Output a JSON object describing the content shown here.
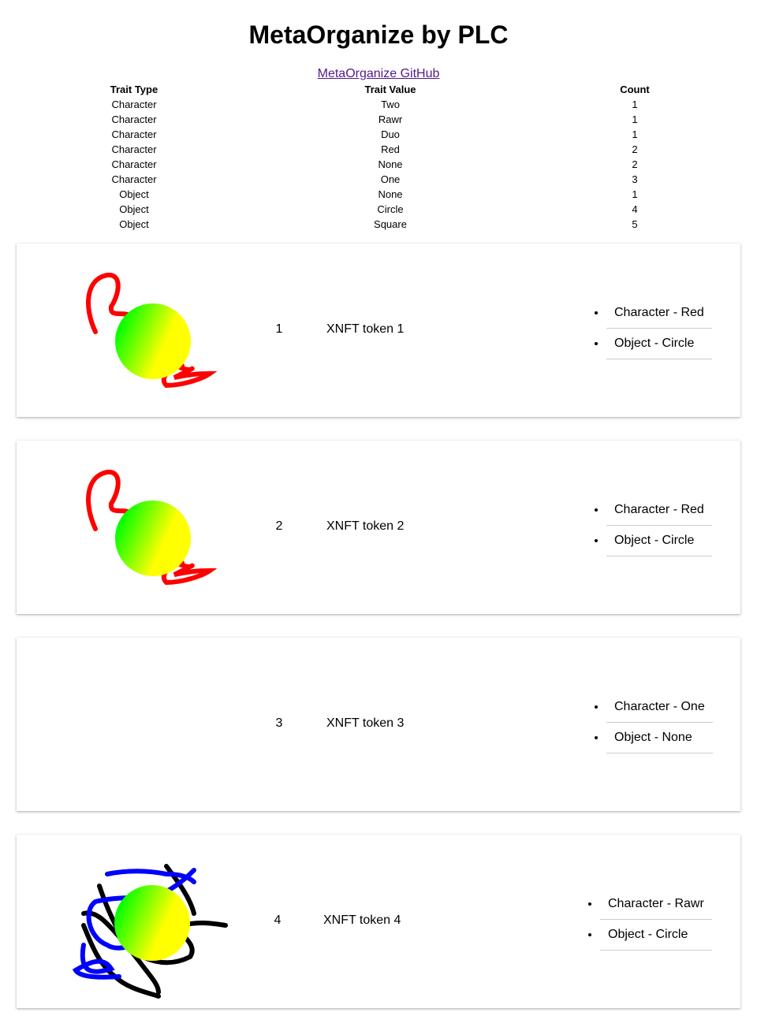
{
  "page_title": "MetaOrganize by PLC",
  "github_link": "MetaOrganize GitHub",
  "trait_table": {
    "headers": [
      "Trait Type",
      "Trait Value",
      "Count"
    ],
    "rows": [
      [
        "Character",
        "Two",
        "1"
      ],
      [
        "Character",
        "Rawr",
        "1"
      ],
      [
        "Character",
        "Duo",
        "1"
      ],
      [
        "Character",
        "Red",
        "2"
      ],
      [
        "Character",
        "None",
        "2"
      ],
      [
        "Character",
        "One",
        "3"
      ],
      [
        "Object",
        "None",
        "1"
      ],
      [
        "Object",
        "Circle",
        "4"
      ],
      [
        "Object",
        "Square",
        "5"
      ]
    ]
  },
  "tokens": [
    {
      "id": "1",
      "name": "XNFT token 1",
      "art": "red-scribble-circle",
      "attributes": [
        "Character - Red",
        "Object - Circle"
      ]
    },
    {
      "id": "2",
      "name": "XNFT token 2",
      "art": "red-scribble-circle",
      "attributes": [
        "Character - Red",
        "Object - Circle"
      ]
    },
    {
      "id": "3",
      "name": "XNFT token 3",
      "art": "none",
      "attributes": [
        "Character - One",
        "Object - None"
      ]
    },
    {
      "id": "4",
      "name": "XNFT token 4",
      "art": "black-blue-scribble-circle",
      "attributes": [
        "Character - Rawr",
        "Object - Circle"
      ]
    }
  ],
  "colors": {
    "link": "#551a8b",
    "scribble_red": "#ff0000",
    "scribble_blue": "#0000ff",
    "circle_from": "#00ff00",
    "circle_to": "#ffff00"
  }
}
